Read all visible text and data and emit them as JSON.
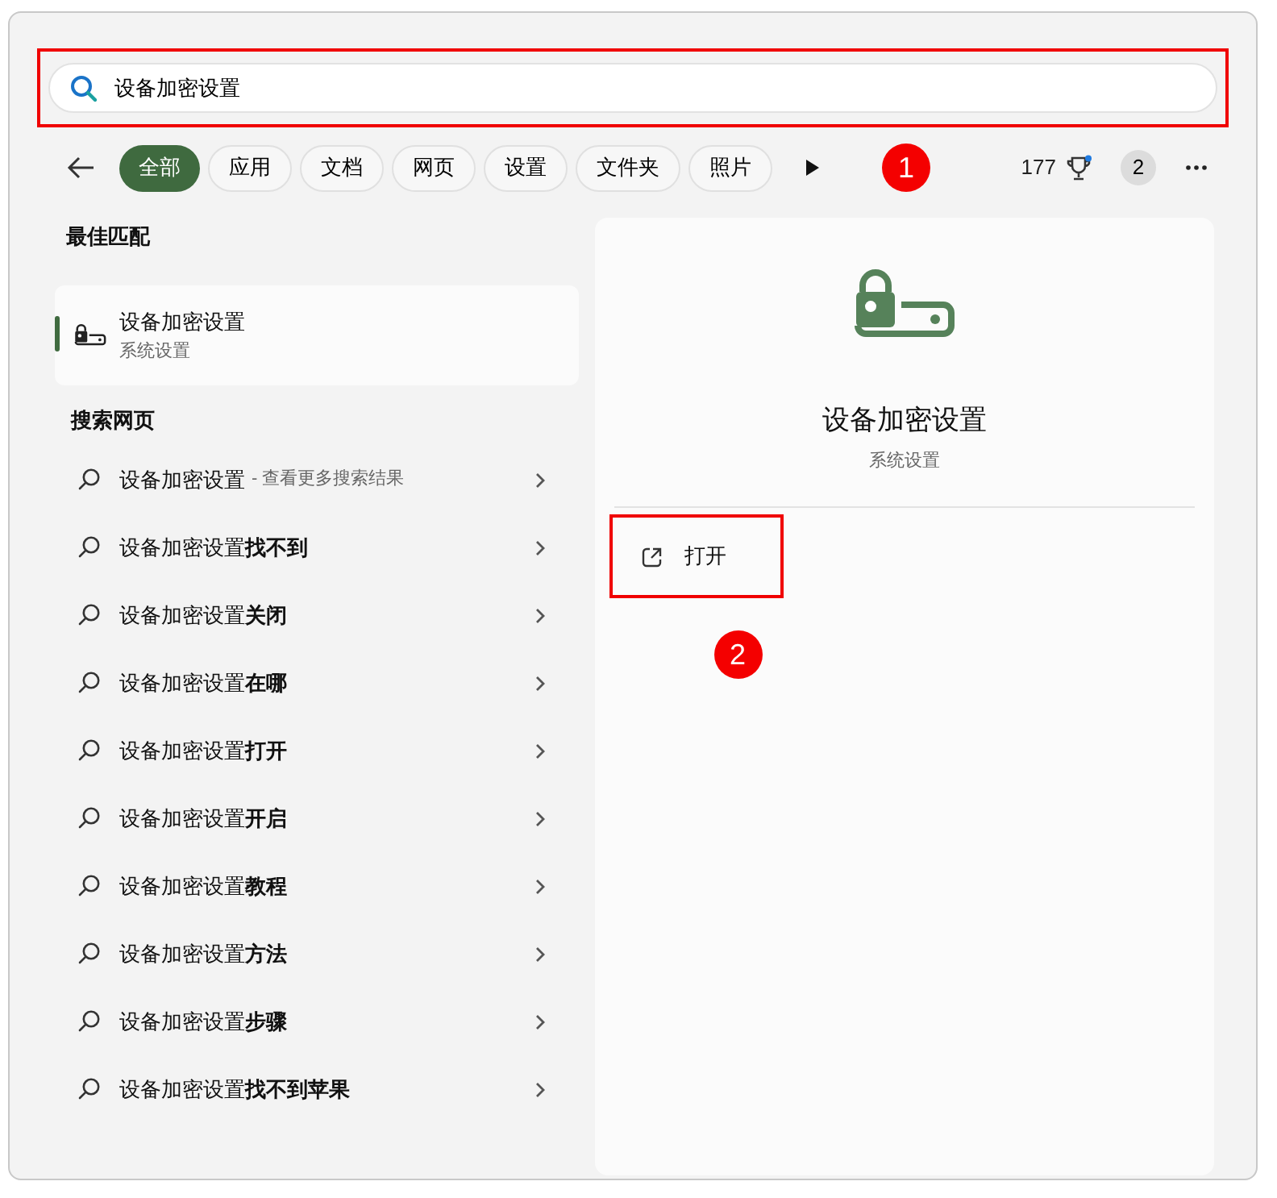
{
  "search": {
    "value": "设备加密设置",
    "highlighted": true
  },
  "filters": [
    {
      "label": "全部",
      "selected": true
    },
    {
      "label": "应用",
      "selected": false
    },
    {
      "label": "文档",
      "selected": false
    },
    {
      "label": "网页",
      "selected": false
    },
    {
      "label": "设置",
      "selected": false
    },
    {
      "label": "文件夹",
      "selected": false
    },
    {
      "label": "照片",
      "selected": false
    }
  ],
  "step_markers": [
    "1",
    "2"
  ],
  "points": "177",
  "notification_count": "2",
  "best_match": {
    "heading": "最佳匹配",
    "title": "设备加密设置",
    "subtitle": "系统设置",
    "selected": true
  },
  "web_search": {
    "heading": "搜索网页",
    "items": [
      {
        "text": "设备加密设置",
        "hint": "- 查看更多搜索结果"
      },
      {
        "text": "设备加密设置**找不到**"
      },
      {
        "text": "设备加密设置**关闭**"
      },
      {
        "text": "设备加密设置**在哪**"
      },
      {
        "text": "设备加密设置**打开**"
      },
      {
        "text": "设备加密设置**开启**"
      },
      {
        "text": "设备加密设置**教程**"
      },
      {
        "text": "设备加密设置**方法**"
      },
      {
        "text": "设备加密设置**步骤**"
      },
      {
        "text": "设备加密设置**找不到苹果**"
      }
    ]
  },
  "detail": {
    "title": "设备加密设置",
    "subtitle": "系统设置",
    "actions": [
      {
        "label": "打开",
        "highlighted": true
      }
    ]
  }
}
